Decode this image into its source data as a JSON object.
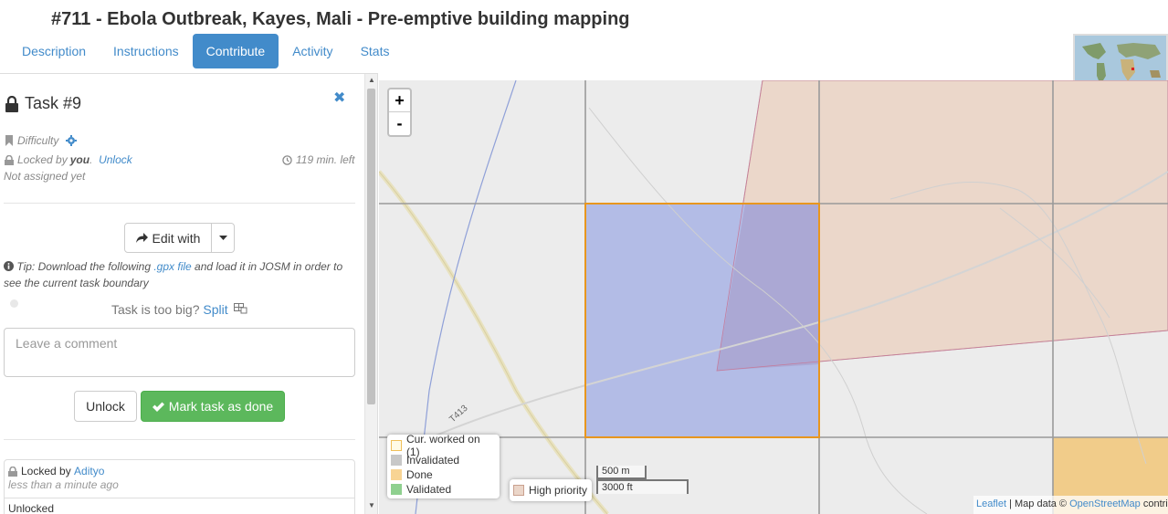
{
  "header": {
    "title": "#711 - Ebola Outbreak, Kayes, Mali - Pre-emptive building mapping"
  },
  "tabs": [
    {
      "label": "Description"
    },
    {
      "label": "Instructions"
    },
    {
      "label": "Contribute",
      "active": true
    },
    {
      "label": "Activity"
    },
    {
      "label": "Stats"
    }
  ],
  "task": {
    "title": "Task #9",
    "difficulty_label": "Difficulty",
    "locked_prefix": "Locked by",
    "locked_user": "you",
    "unlock_link": "Unlock",
    "time_left": "119 min. left",
    "assigned": "Not assigned yet"
  },
  "actions": {
    "edit_with": "Edit with",
    "tip_prefix": "Tip: Download the following",
    "tip_link": ".gpx file",
    "tip_suffix": "and load it in JOSM in order to see the current task boundary",
    "split_question": "Task is too big?",
    "split_link": "Split",
    "comment_placeholder": "Leave a comment",
    "unlock_button": "Unlock",
    "done_button": "Mark task as done"
  },
  "history": [
    {
      "text": "Locked by",
      "user": "Adityo",
      "time": "less than a minute ago"
    },
    {
      "text": "Unlocked"
    }
  ],
  "map": {
    "zoom_in": "+",
    "zoom_out": "-",
    "road_label": "T413",
    "legend": [
      {
        "label": "Cur. worked on (1)",
        "color": "#fffbe6",
        "border": "#f0c05a"
      },
      {
        "label": "Invalidated",
        "color": "#c8c8c8",
        "border": "#c8c8c8"
      },
      {
        "label": "Done",
        "color": "#f8d494",
        "border": "#f8d494"
      },
      {
        "label": "Validated",
        "color": "#8fd08f",
        "border": "#8fd08f"
      }
    ],
    "priority_label": "High priority",
    "scale_metric": "500 m",
    "scale_imperial": "3000 ft",
    "attribution_leaflet": "Leaflet",
    "attribution_mid": "| Map data ©",
    "attribution_osm": "OpenStreetMap",
    "attribution_tail": "contri"
  },
  "colors": {
    "accent": "#428bca",
    "success": "#5cb85c",
    "current_task_fill": "#b8c0e8",
    "current_task_border": "#e8961e",
    "priority_fill": "#ebd6c9"
  }
}
